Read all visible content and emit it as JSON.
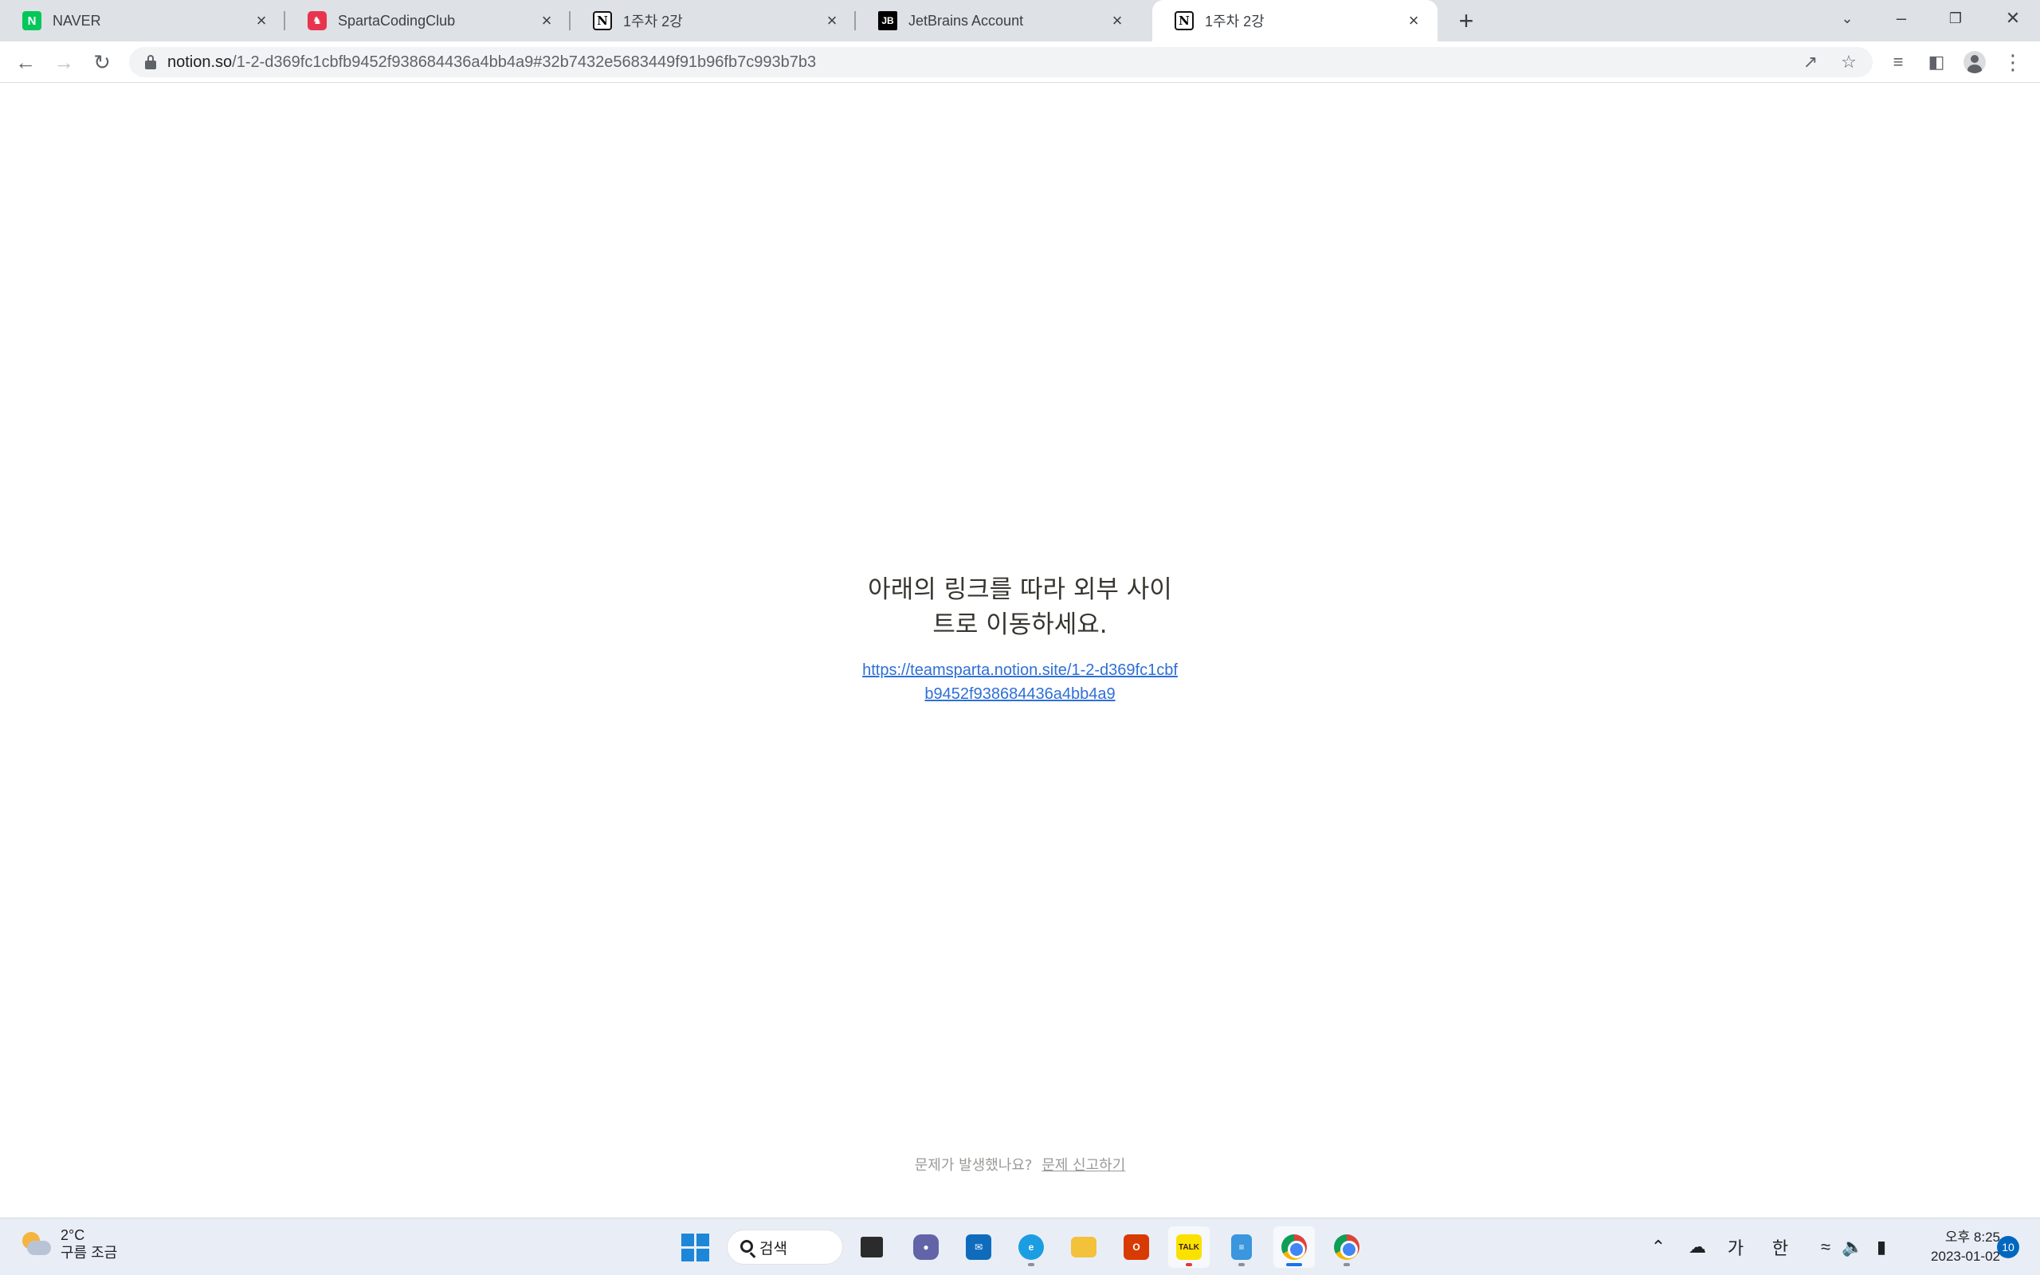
{
  "browser": {
    "tabs": [
      {
        "title": "NAVER",
        "favicon": "N",
        "icon": "naver-icon"
      },
      {
        "title": "SpartaCodingClub",
        "favicon": "♞",
        "icon": "sparta-icon"
      },
      {
        "title": "1주차 2강",
        "favicon": "N",
        "icon": "notion-icon"
      },
      {
        "title": "JetBrains Account",
        "favicon": "JB",
        "icon": "jetbrains-icon"
      },
      {
        "title": "1주차 2강",
        "favicon": "N",
        "icon": "notion-icon",
        "active": true
      }
    ],
    "new_tab_symbol": "+",
    "url_host": "notion.so",
    "url_path": "/1-2-d369fc1cbfb9452f938684436a4bb4a9#32b7432e5683449f91b96fb7c993b7b3"
  },
  "page": {
    "message": "아래의 링크를 따라 외부 사이트로 이동하세요.",
    "link": "https://teamsparta.notion.site/1-2-d369fc1cbfb9452f938684436a4bb4a9",
    "report_question": "문제가 발생했나요?",
    "report_link": "문제 신고하기"
  },
  "taskbar": {
    "weather_temp": "2°C",
    "weather_desc": "구름 조금",
    "search_label": "검색",
    "kakao_label": "TALK",
    "ime_mode": "가",
    "ime_lang": "한",
    "clock_ampm_time": "오후 8:25",
    "clock_date": "2023-01-02",
    "notification_count": "10"
  },
  "colors": {
    "accent": "#1a73e8",
    "link": "#2e6fd6",
    "text": "#37352f"
  }
}
